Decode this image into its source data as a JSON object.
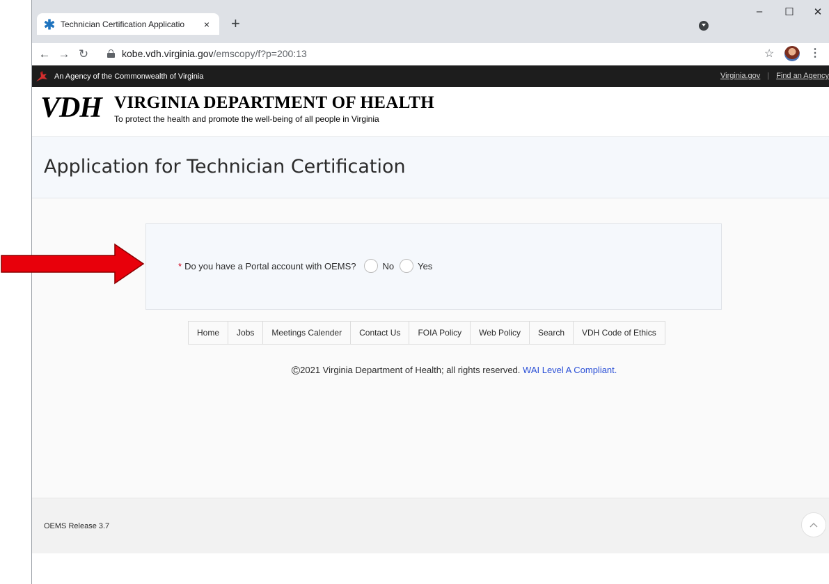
{
  "browser": {
    "tab_title": "Technician Certification Applicatio",
    "tab_close": "×",
    "new_tab": "+",
    "url_host": "kobe.vdh.virginia.gov",
    "url_path": "/emscopy/f?p=200:13",
    "minimize": "–",
    "maximize": "☐",
    "close": "✕"
  },
  "agency_bar": {
    "text": "An Agency of the Commonwealth of Virginia",
    "links": [
      "Virginia.gov",
      "Find an Agency"
    ]
  },
  "header": {
    "logo": "VDH",
    "org_name": "VIRGINIA DEPARTMENT OF HEALTH",
    "tagline": "To protect the health and promote the well-being of all people in Virginia"
  },
  "page": {
    "title": "Application for Technician Certification"
  },
  "form": {
    "required_marker": "*",
    "question": "Do you have a Portal account with OEMS?",
    "options": [
      "No",
      "Yes"
    ]
  },
  "footer_nav": [
    "Home",
    "Jobs",
    "Meetings Calender",
    "Contact Us",
    "FOIA Policy",
    "Web Policy",
    "Search",
    "VDH Code of Ethics"
  ],
  "copyright": {
    "symbol": "©",
    "text": "2021 Virginia Department of Health; all rights reserved.",
    "link": "WAI Level A Compliant."
  },
  "release": {
    "text": "OEMS Release 3.7"
  },
  "colors": {
    "annotation_arrow": "#e8000b",
    "required": "#d0021b",
    "link": "#2a4fd6"
  }
}
